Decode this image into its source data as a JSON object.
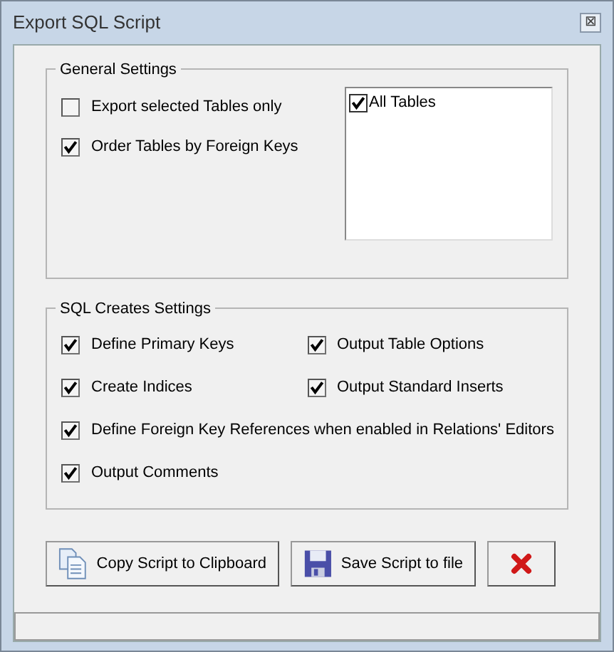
{
  "window": {
    "title": "Export SQL Script",
    "close_glyph": "⊠"
  },
  "general_settings": {
    "title": "General Settings",
    "options": [
      {
        "label": "Export selected Tables only",
        "checked": false
      },
      {
        "label": "Order Tables by Foreign Keys",
        "checked": true
      }
    ],
    "tables": [
      {
        "label": "All Tables",
        "checked": true
      }
    ]
  },
  "sql_creates_settings": {
    "title": "SQL Creates Settings",
    "rows": [
      [
        {
          "label": "Define Primary Keys",
          "checked": true
        },
        {
          "label": "Output Table Options",
          "checked": true
        }
      ],
      [
        {
          "label": "Create Indices",
          "checked": true
        },
        {
          "label": "Output Standard Inserts",
          "checked": true
        }
      ],
      [
        {
          "label": "Define Foreign Key References when enabled in Relations' Editors",
          "checked": true
        }
      ],
      [
        {
          "label": "Output Comments",
          "checked": true
        }
      ]
    ]
  },
  "buttons": [
    {
      "kind": "copy",
      "label": "Copy Script to Clipboard"
    },
    {
      "kind": "save",
      "label": "Save Script to file"
    },
    {
      "kind": "close"
    }
  ]
}
